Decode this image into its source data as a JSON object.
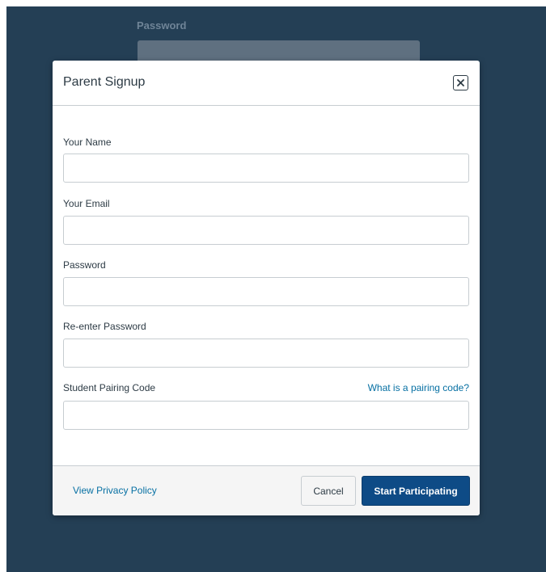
{
  "background": {
    "password_label": "Password"
  },
  "modal": {
    "title": "Parent Signup",
    "close_icon": "close-icon",
    "fields": {
      "name": {
        "label": "Your Name",
        "value": ""
      },
      "email": {
        "label": "Your Email",
        "value": ""
      },
      "password": {
        "label": "Password",
        "value": ""
      },
      "confirm_password": {
        "label": "Re-enter Password",
        "value": ""
      },
      "pairing_code": {
        "label": "Student Pairing Code",
        "value": ""
      }
    },
    "pairing_help_link": "What is a pairing code?",
    "footer": {
      "privacy_link": "View Privacy Policy",
      "cancel_label": "Cancel",
      "submit_label": "Start Participating"
    }
  },
  "colors": {
    "backdrop": "#243f55",
    "primary_button": "#0e4b86",
    "link": "#0770a3"
  }
}
